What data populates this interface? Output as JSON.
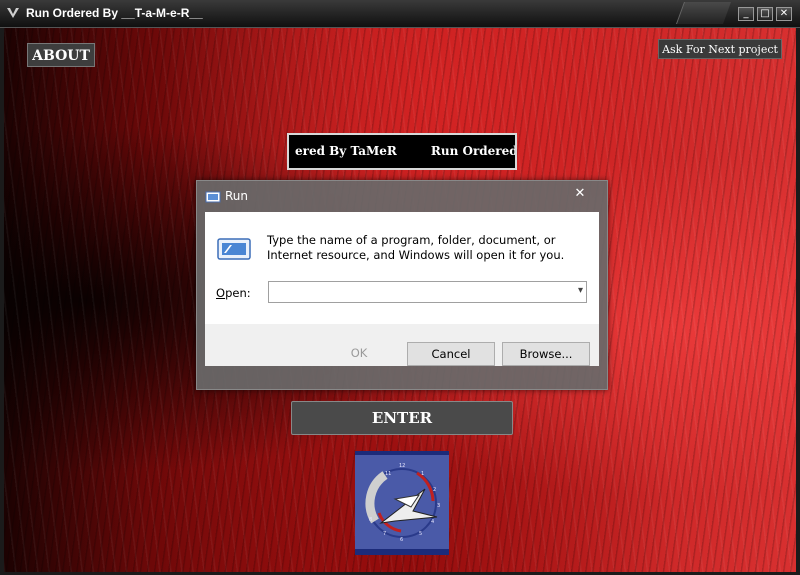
{
  "window": {
    "title": "Run Ordered By __T-a-M-e-R__",
    "controls": {
      "minimize": "_",
      "maximize": "□",
      "close": "✕"
    }
  },
  "main": {
    "about_label": "ABOUT",
    "ask_label": "Ask For Next project",
    "marquee_segments": [
      "ered By TaMeR",
      "Run Ordered Po"
    ],
    "enter_label": "ENTER",
    "logo_icon": "clock-arrow-logo-icon"
  },
  "run_dialog": {
    "title": "Run",
    "close_glyph": "✕",
    "description": "Type the name of a program, folder, document, or Internet resource, and Windows will open it for you.",
    "open_label_prefix": "",
    "open_label_access": "O",
    "open_label_rest": "pen:",
    "open_value": "",
    "ok_label": "OK",
    "cancel_label": "Cancel",
    "browse_label": "Browse..."
  },
  "colors": {
    "background_red": "#c52222",
    "titlebar_dark": "#1b1b1b",
    "logo_blue": "#4a5aa8"
  }
}
